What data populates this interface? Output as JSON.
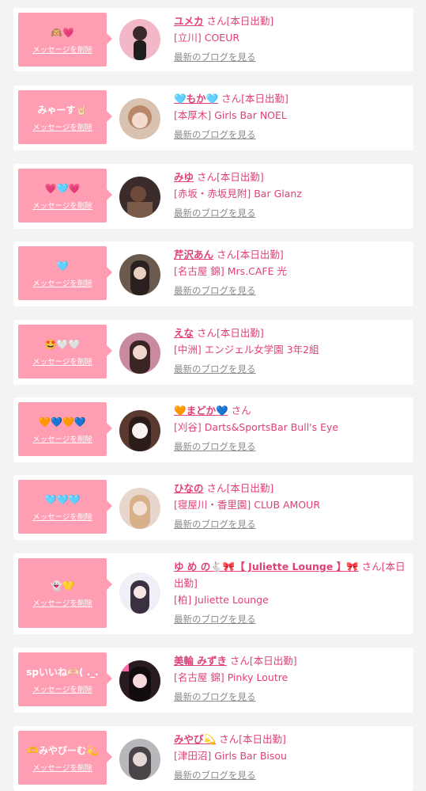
{
  "delete_label": "メッセージを削除",
  "blog_label": "最新のブログを見る",
  "accent_color": "#e0407a",
  "bubble_color": "#ff9eb2",
  "cards": [
    {
      "message": "🙉💗",
      "name": "ユメカ",
      "suffix": "さん[本日出勤]",
      "shop": "[立川] COEUR"
    },
    {
      "message": "みゃーす🤘🏻",
      "name": "🩵もか🩵",
      "suffix": "さん[本日出勤]",
      "shop": "[本厚木] Girls Bar NOEL"
    },
    {
      "message": "💗🩵💗",
      "name": "みゆ",
      "suffix": "さん[本日出勤]",
      "shop": "[赤坂・赤坂見附] Bar Glanz"
    },
    {
      "message": "🩵",
      "name": "芹沢あん",
      "suffix": "さん[本日出勤]",
      "shop": "[名古屋 錦] Mrs.CAFE 光"
    },
    {
      "message": "🤩🤍🤍",
      "name": "えな",
      "suffix": "さん[本日出勤]",
      "shop": "[中洲] エンジェル女学園 3年2組"
    },
    {
      "message": "🧡💙🧡💙",
      "name": "🧡まどか💙",
      "suffix": "さん",
      "shop": "[刈谷] Darts&SportsBar Bull's Eye"
    },
    {
      "message": "🩵🩵🩵",
      "name": "ひなの",
      "suffix": "さん[本日出勤]",
      "shop": "[寝屋川・香里園] CLUB AMOUR"
    },
    {
      "message": "👻💛",
      "name": "ゆ め の🐇🎀【 Juliette Lounge 】🎀",
      "suffix": "さん[本日出勤]",
      "shop": "[柏] Juliette Lounge"
    },
    {
      "message": "spいいね🫶🏻( ._.",
      "name": "美輪 みずき",
      "suffix": "さん[本日出勤]",
      "shop": "[名古屋 錦] Pinky Loutre"
    },
    {
      "message": "🫶みやびーむ💫",
      "name": "みやび💫",
      "suffix": "さん[本日出勤]",
      "shop": "[津田沼] Girls Bar Bisou"
    }
  ]
}
